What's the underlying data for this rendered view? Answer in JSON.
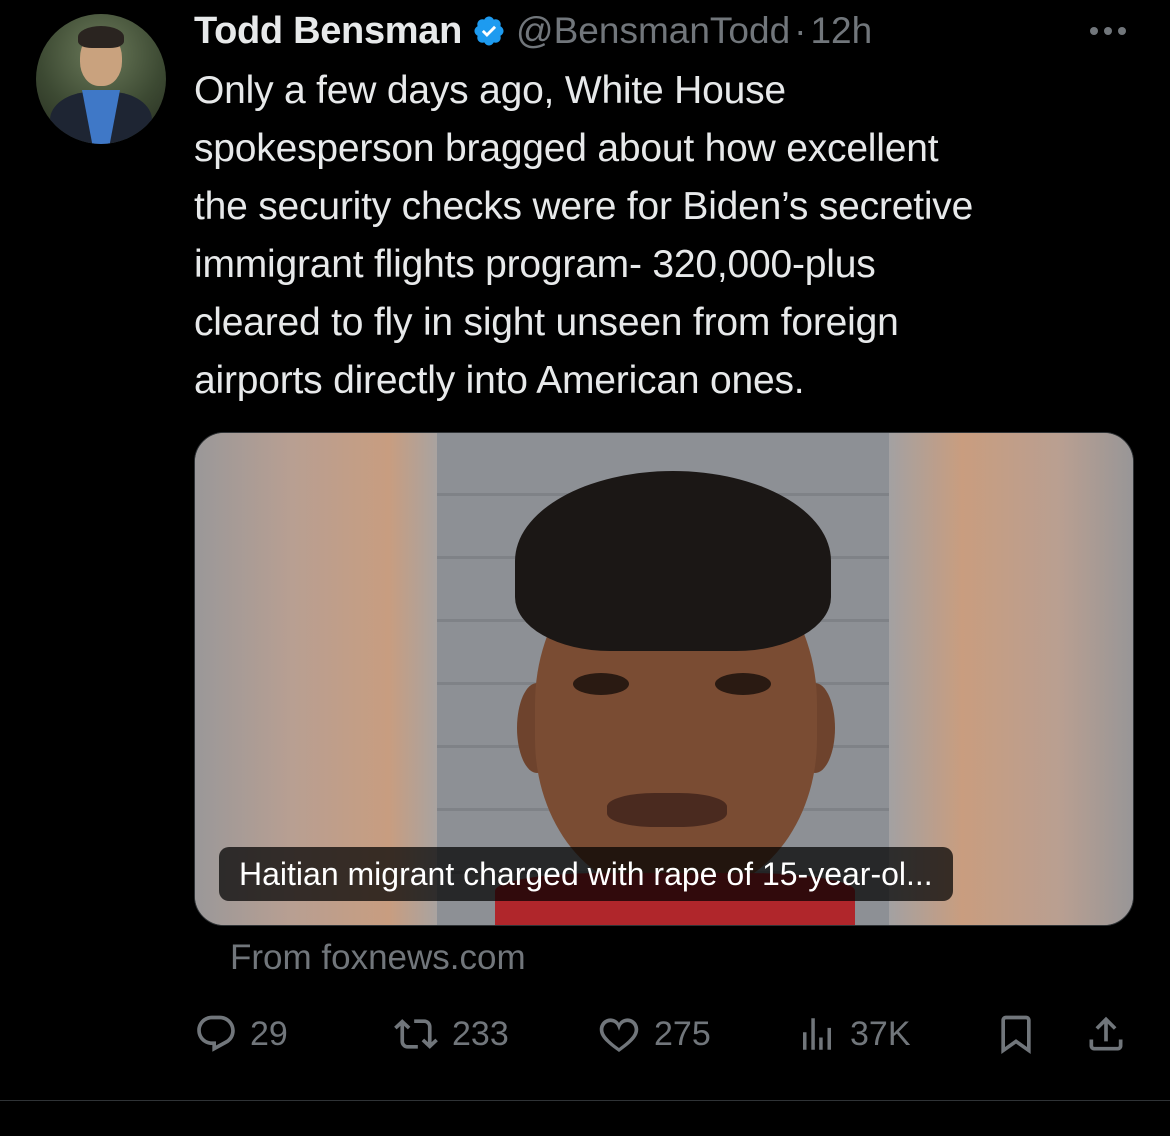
{
  "author": {
    "name": "Todd Bensman",
    "handle": "@BensmanTodd",
    "separator": "·",
    "time": "12h",
    "verified": true,
    "verified_color": "#1d9bf0"
  },
  "tweet": {
    "text": "Only a few days ago, White House\nspokesperson bragged about how excellent\nthe security checks were for Biden’s secretive\nimmigrant flights program- 320,000-plus\ncleared to fly in sight unseen from foreign\nairports directly into American ones."
  },
  "link_card": {
    "caption": "Haitian migrant charged with rape of 15-year-ol...",
    "source": "From foxnews.com"
  },
  "actions": {
    "replies": "29",
    "reposts": "233",
    "likes": "275",
    "views": "37K"
  },
  "icons": {
    "more": "more-horizontal-icon",
    "reply": "reply-icon",
    "repost": "repost-icon",
    "like": "heart-icon",
    "views": "views-icon",
    "bookmark": "bookmark-icon",
    "share": "share-icon"
  },
  "colors": {
    "background": "#000000",
    "text": "#e7e9ea",
    "muted": "#71767b"
  }
}
